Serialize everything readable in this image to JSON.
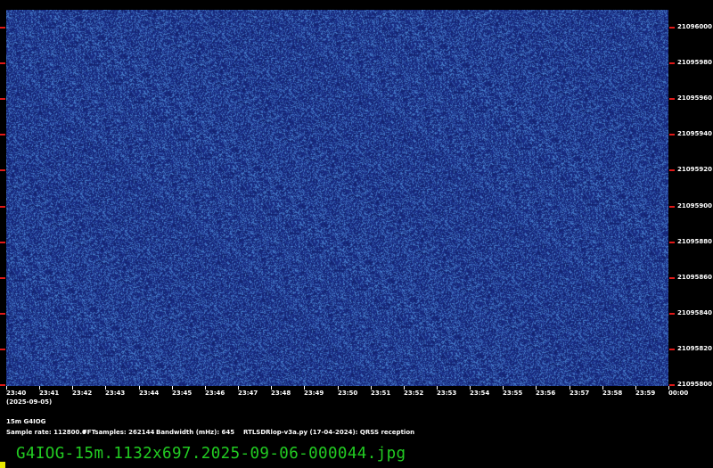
{
  "colors": {
    "background": "#000000",
    "waterfall_base": "#1a2d86",
    "noise_light": "#4d8ad6",
    "noise_dark": "#13236f",
    "tick_mark": "#e01818",
    "text": "#ffffff",
    "filename_text": "#22cc22",
    "corner_mark": "#e8e800"
  },
  "frequency_axis": {
    "labels": [
      "21096000",
      "21095980",
      "21095960",
      "21095940",
      "21095920",
      "21095900",
      "21095880",
      "21095860",
      "21095840",
      "21095820",
      "21095800"
    ]
  },
  "time_axis": {
    "labels": [
      "23:40",
      "23:41",
      "23:42",
      "23:43",
      "23:44",
      "23:45",
      "23:46",
      "23:47",
      "23:48",
      "23:49",
      "23:50",
      "23:51",
      "23:52",
      "23:53",
      "23:54",
      "23:55",
      "23:56",
      "23:57",
      "23:58",
      "23:59",
      "00:00"
    ],
    "date": "(2025-09-05)"
  },
  "info": {
    "station": "15m G4IOG",
    "sample_rate": "Sample rate: 112800.0",
    "fft_samples": "FFTsamples: 262144",
    "bandwidth": "Bandwidth (mHz): 645",
    "software": "RTLSDRlop-v3a.py (17-04-2024): QRSS reception"
  },
  "filename": "G4IOG-15m.1132x697.2025-09-06-000044.jpg"
}
